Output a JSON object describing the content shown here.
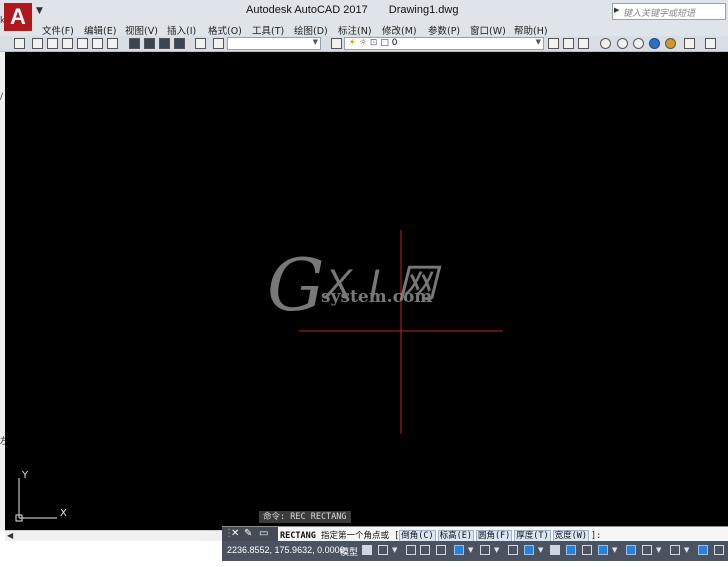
{
  "window": {
    "app_title": "Autodesk AutoCAD 2017",
    "document_title": "Drawing1.dwg",
    "search_placeholder": "键入关键字或短语",
    "logo_letter": "A"
  },
  "menu": [
    "文件(F)",
    "编辑(E)",
    "视图(V)",
    "插入(I)",
    "格式(O)",
    "工具(T)",
    "绘图(D)",
    "标注(N)",
    "修改(M)",
    "参数(P)",
    "窗口(W)",
    "帮助(H)"
  ],
  "toolbar": {
    "layer_value": "0"
  },
  "left_strip": {
    "glyphs": [
      "k",
      "/",
      "左"
    ]
  },
  "canvas": {
    "background": "#000000",
    "crosshair_color": "#c81e1e",
    "ucs_axes": {
      "x": "X",
      "y": "Y"
    }
  },
  "watermark": {
    "g": "G",
    "xi": "X I 网",
    "domain": "system.com"
  },
  "command": {
    "history": "命令: REC RECTANG",
    "prompt_cmd": "RECTANG",
    "prompt_text": "指定第一个角点或",
    "options": [
      "倒角(C)",
      "标高(E)",
      "圆角(F)",
      "厚度(T)",
      "宽度(W)"
    ],
    "suffix": "]:"
  },
  "status": {
    "coordinates": "2236.8552, 175.9632, 0.0000",
    "model_tab": "模型"
  }
}
